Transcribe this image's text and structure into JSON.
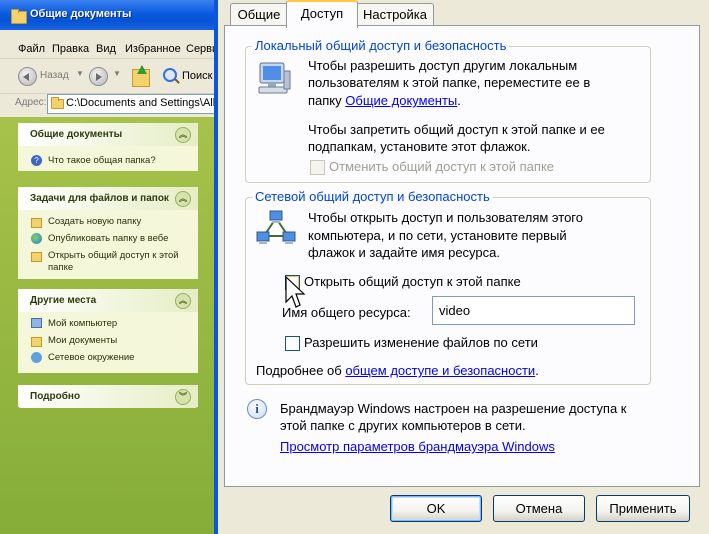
{
  "explorer": {
    "title": "Общие документы",
    "menu": [
      "Файл",
      "Правка",
      "Вид",
      "Избранное",
      "Сервис"
    ],
    "toolbar": {
      "back_label": "Назад",
      "search_label": "Поиск"
    },
    "address": {
      "label": "Адрес:",
      "value": "C:\\Documents and Settings\\All Users\\"
    },
    "panels": [
      {
        "title": "Общие документы",
        "chevron": "up",
        "items": [
          {
            "icon": "help-icon",
            "label": "Что такое общая папка?"
          }
        ]
      },
      {
        "title": "Задачи для файлов и папок",
        "chevron": "up",
        "items": [
          {
            "icon": "new-folder-icon",
            "label": "Создать новую папку"
          },
          {
            "icon": "publish-web-icon",
            "label": "Опубликовать папку в вебе"
          },
          {
            "icon": "share-folder-icon",
            "label": "Открыть общий доступ к этой",
            "label2": "папке"
          }
        ]
      },
      {
        "title": "Другие места",
        "chevron": "up",
        "items": [
          {
            "icon": "my-computer-icon",
            "label": "Мой компьютер"
          },
          {
            "icon": "my-documents-icon",
            "label": "Мои документы"
          },
          {
            "icon": "network-places-icon",
            "label": "Сетевое окружение"
          }
        ]
      },
      {
        "title": "Подробно",
        "chevron": "down",
        "items": []
      }
    ]
  },
  "dialog": {
    "tabs": [
      "Общие",
      "Доступ",
      "Настройка"
    ],
    "active_tab": "Доступ",
    "local": {
      "title": "Локальный общий доступ и безопасность",
      "line1": "Чтобы разрешить доступ другим локальным",
      "line2": "пользователям к этой папке, переместите ее в",
      "line3_prefix": "папку ",
      "line3_link": "Общие документы",
      "line3_suffix": ".",
      "line4": "Чтобы запретить общий доступ к этой папке и ее",
      "line5": "подпапкам, установите этот флажок.",
      "checkbox_label": "Отменить общий доступ к этой папке",
      "checkbox_checked": false,
      "checkbox_enabled": false
    },
    "network": {
      "title": "Сетевой общий доступ и безопасность",
      "line1": "Чтобы открыть доступ и пользователям этого",
      "line2": "компьютера, и по сети, установите первый",
      "line3": "флажок и задайте имя ресурса.",
      "share_checkbox_label": "Открыть общий доступ к этой папке",
      "share_checked": false,
      "share_name_label": "Имя общего ресурса:",
      "share_name_value": "video",
      "allow_change_label": "Разрешить изменение файлов по сети",
      "allow_change_checked": false,
      "more_prefix": "Подробнее об ",
      "more_link": "общем доступе и безопасности",
      "more_suffix": "."
    },
    "firewall": {
      "line1": "Брандмауэр Windows настроен на разрешение доступа к",
      "line2": "этой папке с других компьютеров в сети.",
      "link": "Просмотр параметров брандмауэра Windows"
    },
    "buttons": {
      "ok": "OK",
      "cancel": "Отмена",
      "apply": "Применить"
    }
  }
}
